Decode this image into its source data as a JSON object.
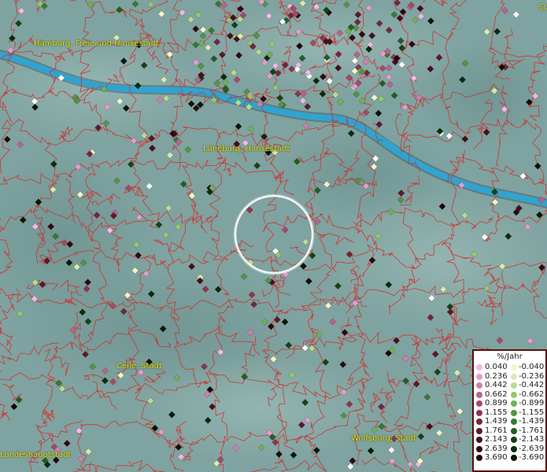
{
  "map": {
    "places": [
      {
        "name": "Hamburg, Freie und Hansestadt"
      },
      {
        "name": "Lüneburg, Hansestadt"
      },
      {
        "name": "Celle, Stadt"
      },
      {
        "name": "Wolfsburg, Stadt"
      },
      {
        "name": "Landeshauptstadt"
      },
      {
        "name": "Sc"
      }
    ],
    "colors": {
      "terrain": "#7fa3a0",
      "river": "#2fa4d0",
      "boundaries": "#d0302e",
      "focus_ring": "#ffffff"
    }
  },
  "legend": {
    "title": "%/Jahr",
    "positive": [
      {
        "label": "0.040",
        "color": "#f4b8e6"
      },
      {
        "label": "0.236",
        "color": "#e59ccd"
      },
      {
        "label": "0.442",
        "color": "#d17fad"
      },
      {
        "label": "0.662",
        "color": "#bb6289"
      },
      {
        "label": "0.899",
        "color": "#a44a6a"
      },
      {
        "label": "1.155",
        "color": "#8d3550"
      },
      {
        "label": "1.439",
        "color": "#76243b"
      },
      {
        "label": "1.761",
        "color": "#5e172a"
      },
      {
        "label": "2.143",
        "color": "#470d1c"
      },
      {
        "label": "2.639",
        "color": "#310610"
      },
      {
        "label": "3.690",
        "color": "#1c0207"
      }
    ],
    "negative": [
      {
        "label": "-0.040",
        "color": "#f2f6c8"
      },
      {
        "label": "-0.236",
        "color": "#d7ebad"
      },
      {
        "label": "-0.442",
        "color": "#b8dc8f"
      },
      {
        "label": "-0.662",
        "color": "#95c872"
      },
      {
        "label": "-0.899",
        "color": "#72b058"
      },
      {
        "label": "-1.155",
        "color": "#529543"
      },
      {
        "label": "-1.439",
        "color": "#377a31"
      },
      {
        "label": "-1.761",
        "color": "#225e22"
      },
      {
        "label": "-2.143",
        "color": "#134415"
      },
      {
        "label": "-2.639",
        "color": "#082c0b"
      },
      {
        "label": "-3.690",
        "color": "#021604"
      }
    ]
  }
}
